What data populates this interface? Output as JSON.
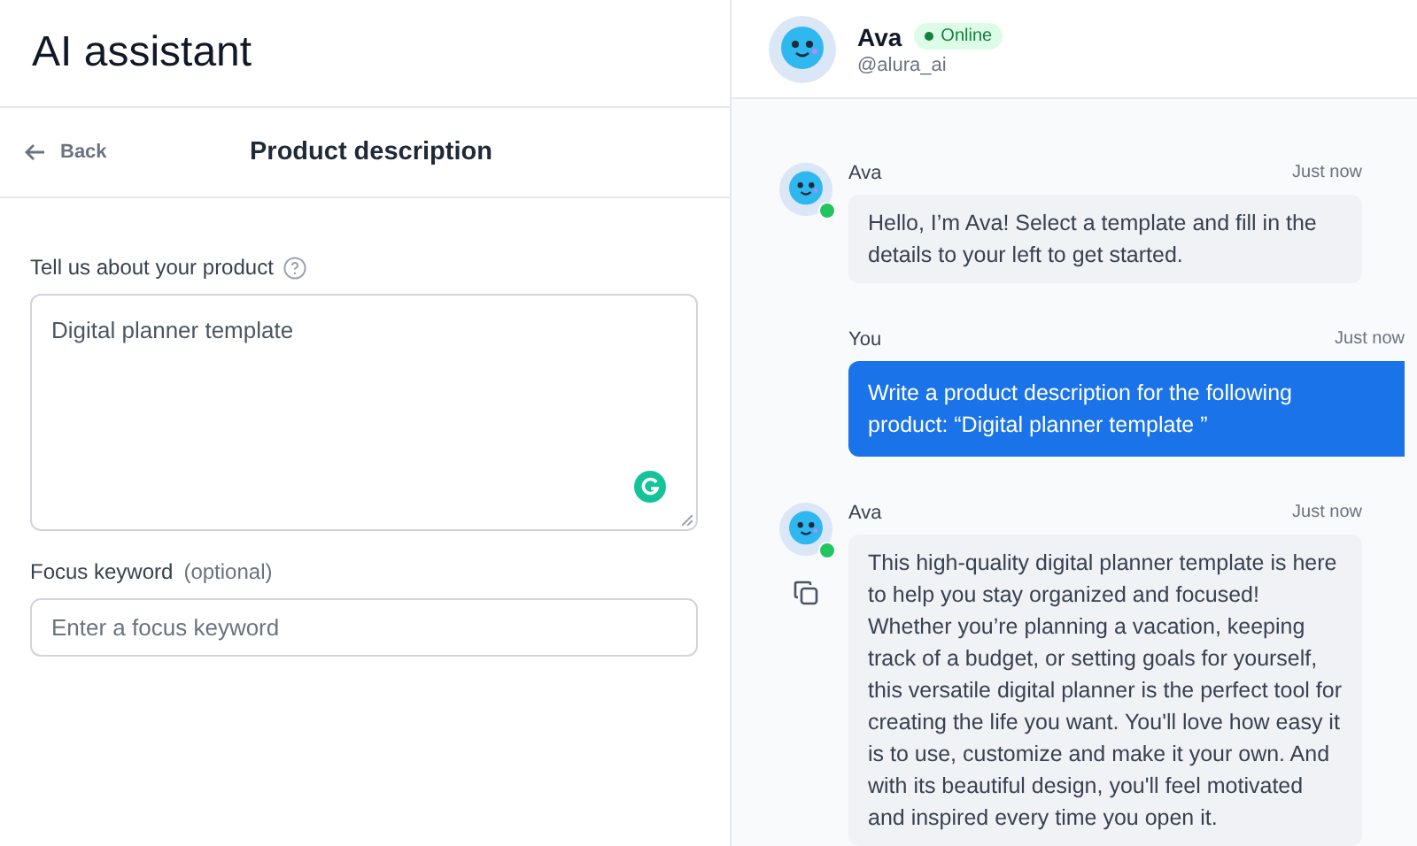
{
  "app_title": "AI assistant",
  "form_header": {
    "back": "Back",
    "title": "Product description"
  },
  "product_field": {
    "label": "Tell us about your product",
    "value": "Digital planner template"
  },
  "keyword_field": {
    "label": "Focus keyword",
    "hint": "(optional)",
    "placeholder": "Enter a focus keyword"
  },
  "chat_header": {
    "name": "Ava",
    "status": "Online",
    "online": true,
    "handle": "@alura_ai"
  },
  "messages": [
    {
      "kind": "assistant",
      "sender": "Ava",
      "time": "Just now",
      "online": true,
      "text": "Hello, I’m Ava! Select a template and fill in the details to your left to get started."
    },
    {
      "kind": "user",
      "sender": "You",
      "time": "Just now",
      "text": "Write a product description for the following product: “Digital planner template ”"
    },
    {
      "kind": "assistant",
      "sender": "Ava",
      "time": "Just now",
      "online": true,
      "copy": true,
      "text": "This high-quality digital planner template is here to help you stay organized and focused! Whether you’re planning a vacation, keeping track of a budget, or setting goals for yourself, this versatile digital planner is the perfect tool for creating the life you want. You'll love how easy it is to use, customize and make it your own. And with its beautiful design, you'll feel motivated and inspired every time you open it."
    }
  ]
}
